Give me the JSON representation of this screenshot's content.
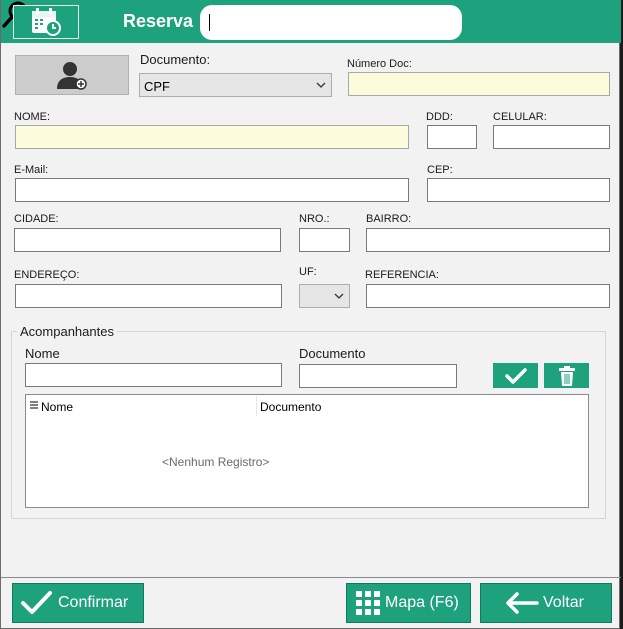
{
  "header": {
    "title": "Reserva",
    "search": {
      "value": "",
      "placeholder": ""
    }
  },
  "form": {
    "documento_label": "Documento:",
    "documento_value": "CPF",
    "numero_doc_label": "Número Doc:",
    "nome_label": "NOME:",
    "ddd_label": "DDD:",
    "celular_label": "CELULAR:",
    "email_label": "E-Mail:",
    "cep_label": "CEP:",
    "cidade_label": "CIDADE:",
    "nro_label": "NRO.:",
    "bairro_label": "BAIRRO:",
    "endereco_label": "ENDEREÇO:",
    "uf_label": "UF:",
    "uf_value": "",
    "referencia_label": "REFERENCIA:"
  },
  "acompanhantes": {
    "title": "Acompanhantes",
    "nome_label": "Nome",
    "documento_label": "Documento",
    "columns": [
      "Nome",
      "Documento"
    ],
    "empty_text": "<Nenhum Registro>"
  },
  "footer": {
    "confirm_label": "Confirmar",
    "map_label": "Mapa (F6)",
    "back_label": "Voltar"
  },
  "colors": {
    "accent": "#1ea27e",
    "required_field": "#fcfcdc"
  }
}
